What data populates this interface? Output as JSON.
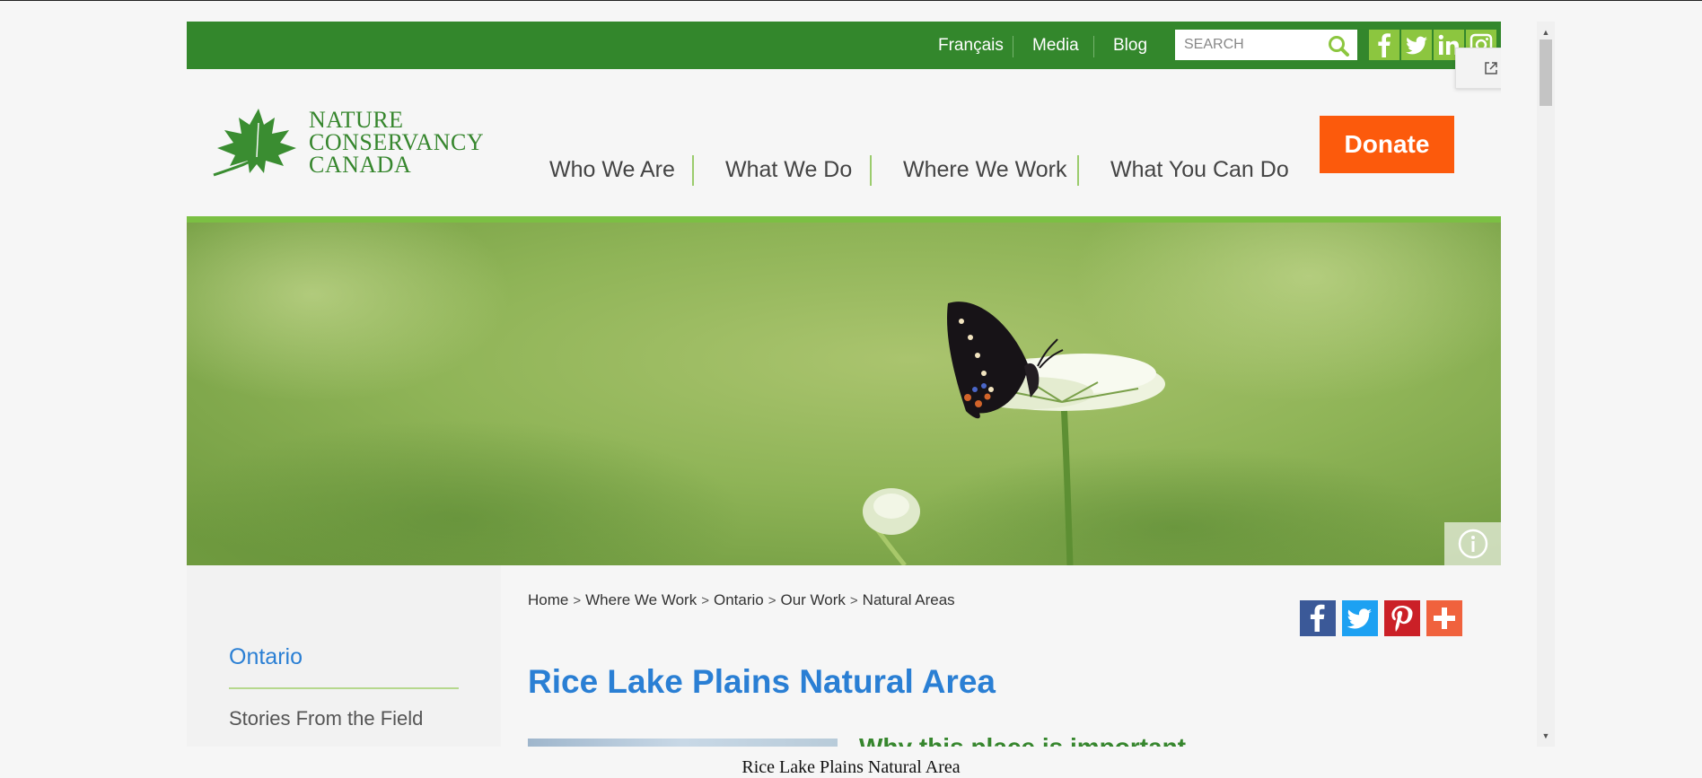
{
  "topbar": {
    "links": [
      "Français",
      "Media",
      "Blog"
    ],
    "search_placeholder": "SEARCH",
    "social": [
      "facebook-icon",
      "twitter-icon",
      "linkedin-icon",
      "instagram-icon"
    ]
  },
  "logo": {
    "line1": "NATURE",
    "line2": "CONSERVANCY",
    "line3": "CANADA"
  },
  "nav": {
    "items": [
      "Who We Are",
      "What We Do",
      "Where We Work",
      "What You Can Do"
    ],
    "donate": "Donate"
  },
  "breadcrumb": [
    "Home",
    "Where We Work",
    "Ontario",
    "Our Work",
    "Natural Areas"
  ],
  "share_icons": [
    "facebook-share-icon",
    "twitter-share-icon",
    "pinterest-share-icon",
    "more-share-icon"
  ],
  "sidebar": {
    "title": "Ontario",
    "items": [
      "Stories From the Field"
    ]
  },
  "main": {
    "title": "Rice Lake Plains Natural Area",
    "subheading": "Why this place is important"
  },
  "caption": "Rice Lake Plains Natural Area",
  "colors": {
    "topbar_green": "#33872c",
    "accent_green": "#7bc043",
    "donate_orange": "#fc5a0c",
    "link_blue": "#2a7fd4"
  }
}
